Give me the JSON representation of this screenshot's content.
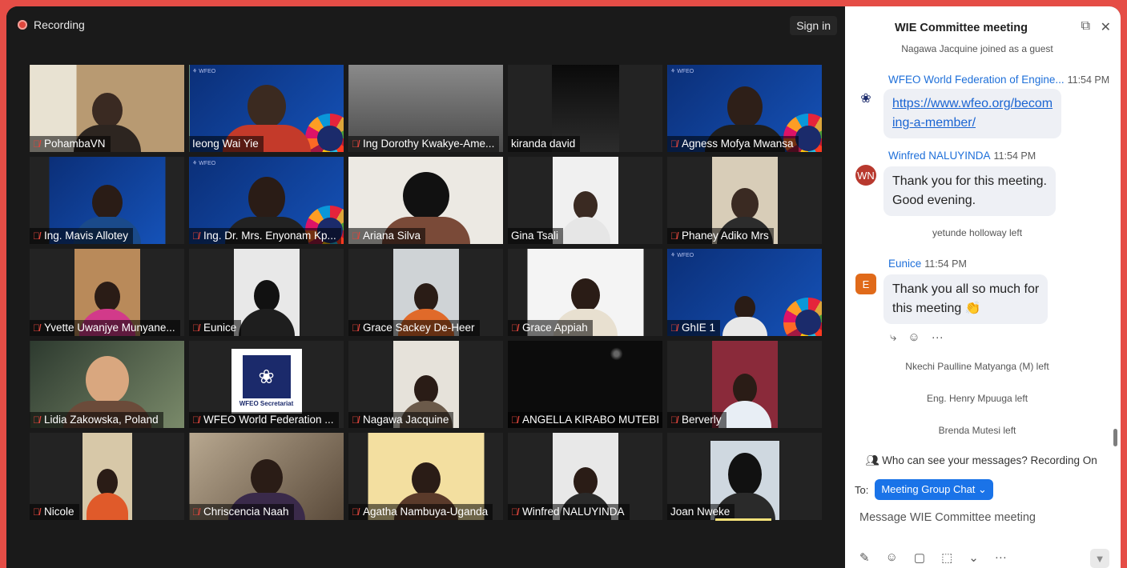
{
  "recording": {
    "label": "Recording"
  },
  "signin": {
    "label": "Sign in"
  },
  "participants": [
    {
      "name": "PohambaVN"
    },
    {
      "name": "Ieong Wai Yie"
    },
    {
      "name": "Ing Dorothy Kwakye-Ame..."
    },
    {
      "name": "kiranda david"
    },
    {
      "name": "Agness Mofya Mwansa"
    },
    {
      "name": "Ing. Mavis Allotey"
    },
    {
      "name": "Ing. Dr. Mrs. Enyonam Kp..."
    },
    {
      "name": "Ariana Silva"
    },
    {
      "name": "Gina Tsali"
    },
    {
      "name": "Phaney Adiko Mrs"
    },
    {
      "name": "Yvette Uwanjye Munyane..."
    },
    {
      "name": "Eunice"
    },
    {
      "name": "Grace Sackey De-Heer"
    },
    {
      "name": "Grace Appiah"
    },
    {
      "name": "GhIE 1"
    },
    {
      "name": "Lidia Zakowska, Poland"
    },
    {
      "name": "WFEO World Federation ..."
    },
    {
      "name": "Nagawa Jacquine"
    },
    {
      "name": "ANGELLA KIRABO MUTEBI"
    },
    {
      "name": "Berverly"
    },
    {
      "name": "Nicole"
    },
    {
      "name": "Chriscencia Naah"
    },
    {
      "name": "Agatha Nambuya-Uganda"
    },
    {
      "name": "Winfred NALUYINDA"
    },
    {
      "name": "Joan Nweke"
    }
  ],
  "wfeo_tile": {
    "caption": "WFEO Secretariat"
  },
  "chat": {
    "title": "WIE Committee meeting",
    "sys_joined": "Nagawa Jacquine joined as a guest",
    "msg1": {
      "sender": "WFEO World Federation of Engine...",
      "time": "11:54 PM",
      "link": "https://www.wfeo.org/becoming-a-member/",
      "link_line1": "https://www.wfeo.org/becom",
      "link_line2": "ing-a-member/"
    },
    "msg2": {
      "sender": "Winfred NALUYINDA",
      "time": "11:54 PM",
      "initials": "WN",
      "text_line1": "Thank you for this meeting.",
      "text_line2": "Good evening."
    },
    "sys_left1": "yetunde holloway left",
    "msg3": {
      "sender": "Eunice",
      "time": "11:54 PM",
      "initials": "E",
      "text_line1": "Thank you all so much for",
      "text_line2": "this meeting",
      "emoji": "👏"
    },
    "sys_left2": "Nkechi Paulline Matyanga (M) left",
    "sys_left3": "Eng. Henry Mpuuga left",
    "sys_left4": "Brenda Mutesi left",
    "visibility": "Who can see your messages? Recording On",
    "to_label": "To:",
    "to_value": "Meeting Group Chat",
    "input_placeholder": "Message WIE Committee meeting"
  },
  "colors": {
    "accent": "#1a73e8",
    "frame": "#e54d46",
    "active_speaker": "#c8e66b",
    "muted": "#e0463c"
  }
}
